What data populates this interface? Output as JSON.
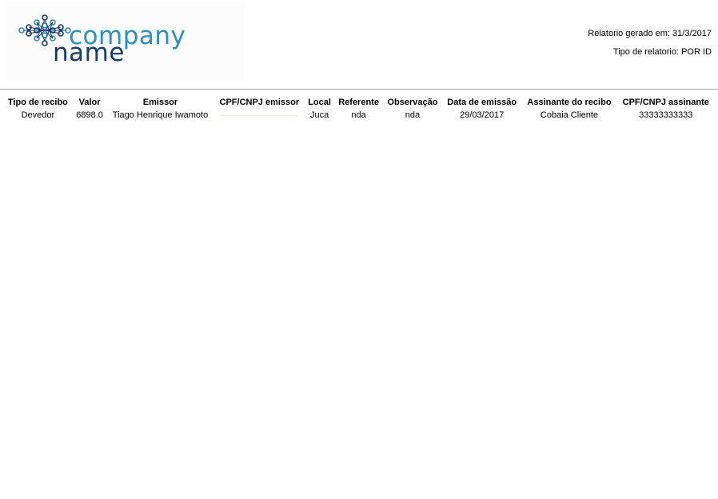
{
  "logo": {
    "line1": "company",
    "line2": "name",
    "colors": {
      "company": "#2a8fc4",
      "name": "#173c6e",
      "knot_dark": "#173c6e",
      "knot_light": "#2a8fc4"
    }
  },
  "meta": {
    "generated": "Relatorio gerado em: 31/3/2017",
    "type": "Tipo de relatorio: POR ID"
  },
  "table": {
    "headers": [
      "Tipo de recibo",
      "Valor",
      "Emissor",
      "CPF/CNPJ emissor",
      "Local",
      "Referente",
      "Observação",
      "Data de emissão",
      "Assinante do recibo",
      "CPF/CNPJ assinante"
    ],
    "rows": [
      [
        "Devedor",
        "6898.0",
        "Tiago Henrique Iwamoto",
        "",
        "Juca",
        "nda",
        "nda",
        "29/03/2017",
        "Cobaia Cliente",
        "33333333333"
      ]
    ]
  }
}
